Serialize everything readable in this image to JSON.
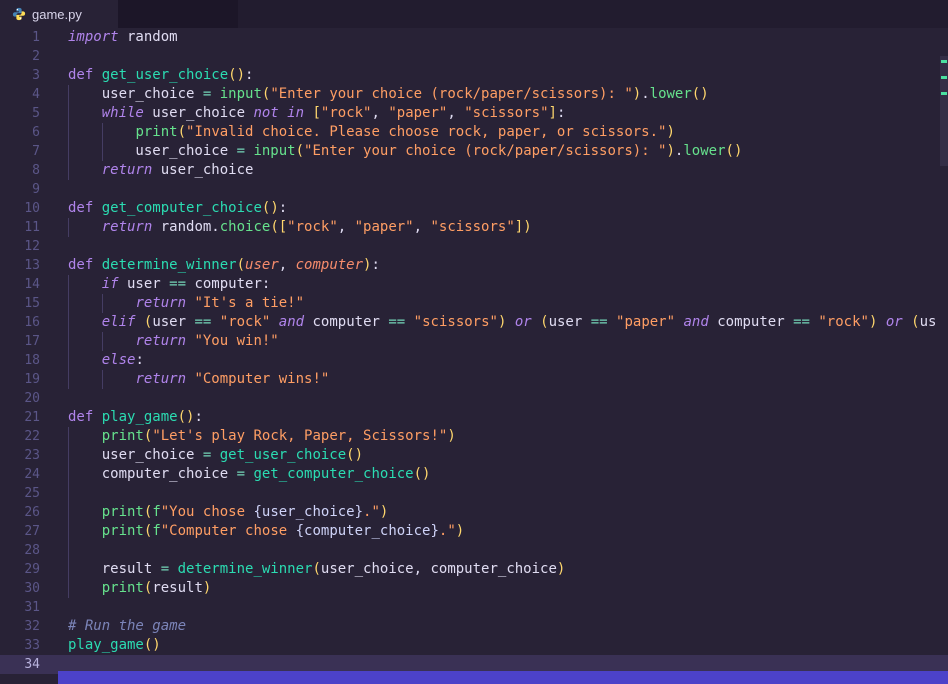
{
  "tab": {
    "label": "game.py"
  },
  "editor": {
    "active_line": 34,
    "palette": {
      "bg": "#282236",
      "tabbar_bg": "#221c2f",
      "tab_active_bg": "#282236",
      "tab_ghost_bg": "#1c1628",
      "tab_label": "#d8d4ea",
      "gutter": "#5b5688",
      "gutter_active": "#b8b2dd",
      "active_line_bg": "#3a3155",
      "guide": "#453d63",
      "scrollbar_blue": "#4c42c9",
      "plain": "#e0dcf2",
      "kw": "#b084eb",
      "fn": "#2bdcb2",
      "builtin": "#66e28d",
      "str": "#ff9e64",
      "op": "#74d6b8",
      "param": "#f78c6c",
      "comment": "#7b84b8",
      "br": "#ffd76d",
      "interp": "#cfd3f8"
    },
    "ruler_marks": [
      {
        "y": 32,
        "c": "#4ae0a0"
      },
      {
        "y": 48,
        "c": "#4ae0a0"
      },
      {
        "y": 64,
        "c": "#4ae0a0"
      }
    ],
    "lines": [
      {
        "n": 1,
        "g": 0,
        "t": [
          [
            "kwi",
            "import"
          ],
          [
            "plain",
            " random"
          ]
        ]
      },
      {
        "n": 2,
        "g": 0,
        "t": []
      },
      {
        "n": 3,
        "g": 0,
        "t": [
          [
            "kw",
            "def"
          ],
          [
            "plain",
            " "
          ],
          [
            "fn",
            "get_user_choice"
          ],
          [
            "br",
            "()"
          ],
          [
            "plain",
            ":"
          ]
        ]
      },
      {
        "n": 4,
        "g": 1,
        "t": [
          [
            "plain",
            "    user_choice "
          ],
          [
            "op",
            "="
          ],
          [
            "plain",
            " "
          ],
          [
            "builtin",
            "input"
          ],
          [
            "br",
            "("
          ],
          [
            "str",
            "\"Enter your choice (rock/paper/scissors): \""
          ],
          [
            "br",
            ")"
          ],
          [
            "plain",
            "."
          ],
          [
            "builtin",
            "lower"
          ],
          [
            "br",
            "()"
          ]
        ]
      },
      {
        "n": 5,
        "g": 1,
        "t": [
          [
            "plain",
            "    "
          ],
          [
            "kwi",
            "while"
          ],
          [
            "plain",
            " user_choice "
          ],
          [
            "kwi",
            "not in"
          ],
          [
            "plain",
            " "
          ],
          [
            "br",
            "["
          ],
          [
            "str",
            "\"rock\""
          ],
          [
            "plain",
            ", "
          ],
          [
            "str",
            "\"paper\""
          ],
          [
            "plain",
            ", "
          ],
          [
            "str",
            "\"scissors\""
          ],
          [
            "br",
            "]"
          ],
          [
            "plain",
            ":"
          ]
        ]
      },
      {
        "n": 6,
        "g": 2,
        "t": [
          [
            "plain",
            "        "
          ],
          [
            "builtin",
            "print"
          ],
          [
            "br",
            "("
          ],
          [
            "str",
            "\"Invalid choice. Please choose rock, paper, or scissors.\""
          ],
          [
            "br",
            ")"
          ]
        ]
      },
      {
        "n": 7,
        "g": 2,
        "t": [
          [
            "plain",
            "        user_choice "
          ],
          [
            "op",
            "="
          ],
          [
            "plain",
            " "
          ],
          [
            "builtin",
            "input"
          ],
          [
            "br",
            "("
          ],
          [
            "str",
            "\"Enter your choice (rock/paper/scissors): \""
          ],
          [
            "br",
            ")"
          ],
          [
            "plain",
            "."
          ],
          [
            "builtin",
            "lower"
          ],
          [
            "br",
            "()"
          ]
        ]
      },
      {
        "n": 8,
        "g": 1,
        "t": [
          [
            "plain",
            "    "
          ],
          [
            "kwi",
            "return"
          ],
          [
            "plain",
            " user_choice"
          ]
        ]
      },
      {
        "n": 9,
        "g": 0,
        "t": []
      },
      {
        "n": 10,
        "g": 0,
        "t": [
          [
            "kw",
            "def"
          ],
          [
            "plain",
            " "
          ],
          [
            "fn",
            "get_computer_choice"
          ],
          [
            "br",
            "()"
          ],
          [
            "plain",
            ":"
          ]
        ]
      },
      {
        "n": 11,
        "g": 1,
        "t": [
          [
            "plain",
            "    "
          ],
          [
            "kwi",
            "return"
          ],
          [
            "plain",
            " random."
          ],
          [
            "builtin",
            "choice"
          ],
          [
            "br",
            "(["
          ],
          [
            "str",
            "\"rock\""
          ],
          [
            "plain",
            ", "
          ],
          [
            "str",
            "\"paper\""
          ],
          [
            "plain",
            ", "
          ],
          [
            "str",
            "\"scissors\""
          ],
          [
            "br",
            "])"
          ]
        ]
      },
      {
        "n": 12,
        "g": 0,
        "t": []
      },
      {
        "n": 13,
        "g": 0,
        "t": [
          [
            "kw",
            "def"
          ],
          [
            "plain",
            " "
          ],
          [
            "fn",
            "determine_winner"
          ],
          [
            "br",
            "("
          ],
          [
            "param",
            "user"
          ],
          [
            "plain",
            ", "
          ],
          [
            "param",
            "computer"
          ],
          [
            "br",
            ")"
          ],
          [
            "plain",
            ":"
          ]
        ]
      },
      {
        "n": 14,
        "g": 1,
        "t": [
          [
            "plain",
            "    "
          ],
          [
            "kwi",
            "if"
          ],
          [
            "plain",
            " user "
          ],
          [
            "op",
            "=="
          ],
          [
            "plain",
            " computer:"
          ]
        ]
      },
      {
        "n": 15,
        "g": 2,
        "t": [
          [
            "plain",
            "        "
          ],
          [
            "kwi",
            "return"
          ],
          [
            "plain",
            " "
          ],
          [
            "str",
            "\"It's a tie!\""
          ]
        ]
      },
      {
        "n": 16,
        "g": 1,
        "t": [
          [
            "plain",
            "    "
          ],
          [
            "kwi",
            "elif"
          ],
          [
            "plain",
            " "
          ],
          [
            "br",
            "("
          ],
          [
            "plain",
            "user "
          ],
          [
            "op",
            "=="
          ],
          [
            "plain",
            " "
          ],
          [
            "str",
            "\"rock\""
          ],
          [
            "plain",
            " "
          ],
          [
            "kwi",
            "and"
          ],
          [
            "plain",
            " computer "
          ],
          [
            "op",
            "=="
          ],
          [
            "plain",
            " "
          ],
          [
            "str",
            "\"scissors\""
          ],
          [
            "br",
            ")"
          ],
          [
            "plain",
            " "
          ],
          [
            "kwi",
            "or"
          ],
          [
            "plain",
            " "
          ],
          [
            "br",
            "("
          ],
          [
            "plain",
            "user "
          ],
          [
            "op",
            "=="
          ],
          [
            "plain",
            " "
          ],
          [
            "str",
            "\"paper\""
          ],
          [
            "plain",
            " "
          ],
          [
            "kwi",
            "and"
          ],
          [
            "plain",
            " computer "
          ],
          [
            "op",
            "=="
          ],
          [
            "plain",
            " "
          ],
          [
            "str",
            "\"rock\""
          ],
          [
            "br",
            ")"
          ],
          [
            "plain",
            " "
          ],
          [
            "kwi",
            "or"
          ],
          [
            "plain",
            " "
          ],
          [
            "br",
            "("
          ],
          [
            "plain",
            "us"
          ]
        ]
      },
      {
        "n": 17,
        "g": 2,
        "t": [
          [
            "plain",
            "        "
          ],
          [
            "kwi",
            "return"
          ],
          [
            "plain",
            " "
          ],
          [
            "str",
            "\"You win!\""
          ]
        ]
      },
      {
        "n": 18,
        "g": 1,
        "t": [
          [
            "plain",
            "    "
          ],
          [
            "kwi",
            "else"
          ],
          [
            "plain",
            ":"
          ]
        ]
      },
      {
        "n": 19,
        "g": 2,
        "t": [
          [
            "plain",
            "        "
          ],
          [
            "kwi",
            "return"
          ],
          [
            "plain",
            " "
          ],
          [
            "str",
            "\"Computer wins!\""
          ]
        ]
      },
      {
        "n": 20,
        "g": 0,
        "t": []
      },
      {
        "n": 21,
        "g": 0,
        "t": [
          [
            "kw",
            "def"
          ],
          [
            "plain",
            " "
          ],
          [
            "fn",
            "play_game"
          ],
          [
            "br",
            "()"
          ],
          [
            "plain",
            ":"
          ]
        ]
      },
      {
        "n": 22,
        "g": 1,
        "t": [
          [
            "plain",
            "    "
          ],
          [
            "builtin",
            "print"
          ],
          [
            "br",
            "("
          ],
          [
            "str",
            "\"Let's play Rock, Paper, Scissors!\""
          ],
          [
            "br",
            ")"
          ]
        ]
      },
      {
        "n": 23,
        "g": 1,
        "t": [
          [
            "plain",
            "    user_choice "
          ],
          [
            "op",
            "="
          ],
          [
            "plain",
            " "
          ],
          [
            "fn",
            "get_user_choice"
          ],
          [
            "br",
            "()"
          ]
        ]
      },
      {
        "n": 24,
        "g": 1,
        "t": [
          [
            "plain",
            "    computer_choice "
          ],
          [
            "op",
            "="
          ],
          [
            "plain",
            " "
          ],
          [
            "fn",
            "get_computer_choice"
          ],
          [
            "br",
            "()"
          ]
        ]
      },
      {
        "n": 25,
        "g": 1,
        "t": []
      },
      {
        "n": 26,
        "g": 1,
        "t": [
          [
            "plain",
            "    "
          ],
          [
            "builtin",
            "print"
          ],
          [
            "br",
            "("
          ],
          [
            "builtin",
            "f"
          ],
          [
            "str",
            "\"You chose "
          ],
          [
            "interp",
            "{user_choice}"
          ],
          [
            "str",
            ".\""
          ],
          [
            "br",
            ")"
          ]
        ]
      },
      {
        "n": 27,
        "g": 1,
        "t": [
          [
            "plain",
            "    "
          ],
          [
            "builtin",
            "print"
          ],
          [
            "br",
            "("
          ],
          [
            "builtin",
            "f"
          ],
          [
            "str",
            "\"Computer chose "
          ],
          [
            "interp",
            "{computer_choice}"
          ],
          [
            "str",
            ".\""
          ],
          [
            "br",
            ")"
          ]
        ]
      },
      {
        "n": 28,
        "g": 1,
        "t": []
      },
      {
        "n": 29,
        "g": 1,
        "t": [
          [
            "plain",
            "    result "
          ],
          [
            "op",
            "="
          ],
          [
            "plain",
            " "
          ],
          [
            "fn",
            "determine_winner"
          ],
          [
            "br",
            "("
          ],
          [
            "plain",
            "user_choice, computer_choice"
          ],
          [
            "br",
            ")"
          ]
        ]
      },
      {
        "n": 30,
        "g": 1,
        "t": [
          [
            "plain",
            "    "
          ],
          [
            "builtin",
            "print"
          ],
          [
            "br",
            "("
          ],
          [
            "plain",
            "result"
          ],
          [
            "br",
            ")"
          ]
        ]
      },
      {
        "n": 31,
        "g": 0,
        "t": []
      },
      {
        "n": 32,
        "g": 0,
        "t": [
          [
            "comment",
            "# Run the game"
          ]
        ]
      },
      {
        "n": 33,
        "g": 0,
        "t": [
          [
            "fn",
            "play_game"
          ],
          [
            "br",
            "()"
          ]
        ]
      },
      {
        "n": 34,
        "g": 0,
        "t": []
      }
    ]
  }
}
